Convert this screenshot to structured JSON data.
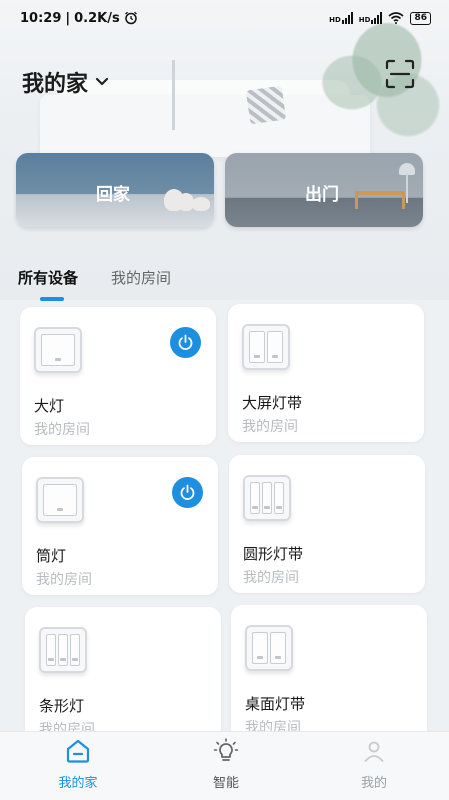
{
  "status_bar": {
    "time": "10:29",
    "speed": "0.2K/s",
    "network_1": "HD",
    "network_2": "HD",
    "battery": "86"
  },
  "header": {
    "title": "我的家"
  },
  "scenes": [
    {
      "label": "回家"
    },
    {
      "label": "出门"
    }
  ],
  "tabs": [
    {
      "label": "所有设备",
      "active": true
    },
    {
      "label": "我的房间",
      "active": false
    }
  ],
  "devices": [
    {
      "name": "大灯",
      "room": "我的房间",
      "gangs": 1,
      "power_on": true
    },
    {
      "name": "大屏灯带",
      "room": "我的房间",
      "gangs": 2,
      "power_on": false
    },
    {
      "name": "筒灯",
      "room": "我的房间",
      "gangs": 1,
      "power_on": true
    },
    {
      "name": "圆形灯带",
      "room": "我的房间",
      "gangs": 3,
      "power_on": false
    },
    {
      "name": "条形灯",
      "room": "我的房间",
      "gangs": 3,
      "power_on": false
    },
    {
      "name": "桌面灯带",
      "room": "我的房间",
      "gangs": 2,
      "power_on": false
    }
  ],
  "bottom_nav": [
    {
      "label": "我的家",
      "active": true,
      "icon": "home-icon"
    },
    {
      "label": "智能",
      "active": false,
      "icon": "bulb-icon"
    },
    {
      "label": "我的",
      "active": false,
      "icon": "person-icon"
    }
  ],
  "colors": {
    "accent": "#1e8fe0",
    "power_button": "#1d8fe1",
    "room_text": "#b7bcc1"
  }
}
